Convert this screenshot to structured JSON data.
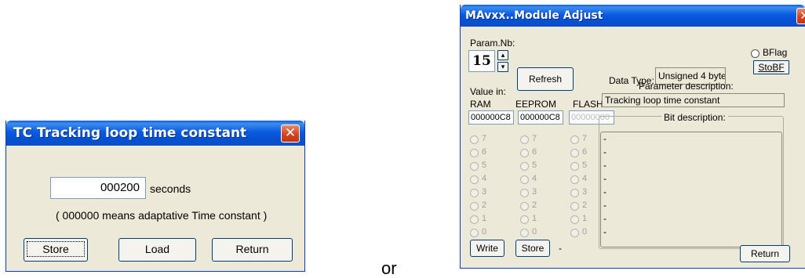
{
  "dialog1": {
    "title": "TC Tracking loop time constant",
    "value": "000200",
    "unit": "seconds",
    "note": "( 000000  means adaptative Time constant )",
    "buttons": {
      "store": "Store",
      "load": "Load",
      "return": "Return"
    }
  },
  "separator": "or",
  "dialog2": {
    "title": "MAvxx..Module Adjust",
    "param_label": "Param.Nb:",
    "param_value": "15",
    "refresh": "Refresh",
    "data_type_label": "Data Type:",
    "data_type_value": "Unsigned 4 byte",
    "bflag_label": "BFlag",
    "stobf": "StoBF",
    "param_desc_label": "Parameter description:",
    "value_in": "Value in:",
    "ram": "RAM",
    "eeprom": "EEPROM",
    "flash": "FLASH",
    "param_desc_value": "Tracking loop time constant",
    "ram_value": "000000C8",
    "eeprom_value": "000000C8",
    "flash_value": "00000000",
    "bit_desc_label": "Bit description:",
    "bits": [
      "7",
      "6",
      "5",
      "4",
      "3",
      "2",
      "1",
      "0"
    ],
    "bit_descs": [
      "-",
      "-",
      "-",
      "-",
      "-",
      "-",
      "-",
      "-"
    ],
    "write": "Write",
    "store": "Store",
    "status": "-",
    "return": "Return"
  }
}
